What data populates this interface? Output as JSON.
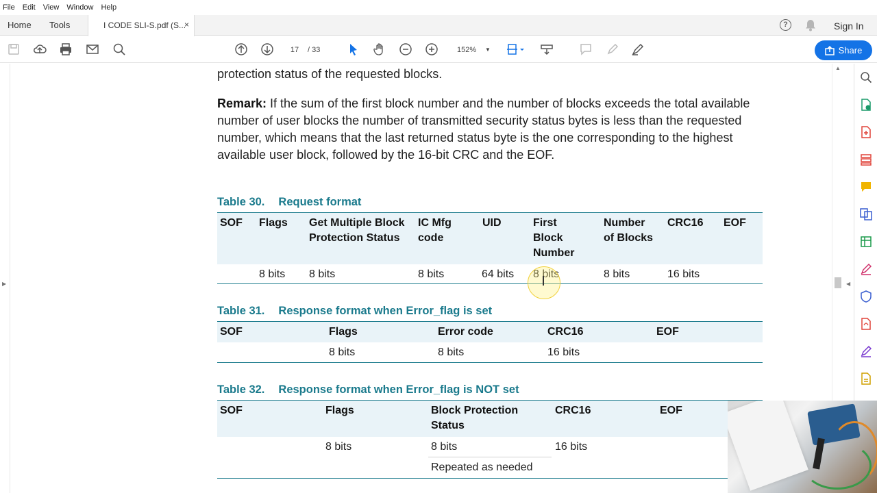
{
  "menu": [
    "File",
    "Edit",
    "View",
    "Window",
    "Help"
  ],
  "tabs": {
    "home": "Home",
    "tools": "Tools",
    "document": "I CODE SLI-S.pdf (S...",
    "close": "×"
  },
  "header": {
    "help": "?",
    "sign_in": "Sign In"
  },
  "toolbar": {
    "current_page": "17",
    "total_pages": "/ 33",
    "zoom": "152%",
    "share_label": "Share"
  },
  "document": {
    "intro_line": "protection status of the requested blocks.",
    "remark_label": "Remark:",
    "remark_text": " If the sum of the first block number and the number of blocks exceeds the total available number of user blocks the number of transmitted security status bytes is less than the requested number, which means that the last returned status byte is the one corresponding to the highest available user block, followed by the 16-bit CRC and the EOF.",
    "table30": {
      "number": "Table 30.",
      "title": "Request format",
      "headers": [
        "SOF",
        "Flags",
        "Get Multiple Block Protection Status",
        "IC Mfg code",
        "UID",
        "First Block Number",
        "Number of Blocks",
        "CRC16",
        "EOF"
      ],
      "row": [
        "",
        "8 bits",
        "8 bits",
        "8 bits",
        "64 bits",
        "8 bits",
        "8 bits",
        "16 bits",
        ""
      ]
    },
    "table31": {
      "number": "Table 31.",
      "title": "Response format when Error_flag is set",
      "headers": [
        "SOF",
        "Flags",
        "Error code",
        "CRC16",
        "EOF"
      ],
      "row": [
        "",
        "8 bits",
        "8 bits",
        "16 bits",
        ""
      ]
    },
    "table32": {
      "number": "Table 32.",
      "title": "Response format when Error_flag is NOT set",
      "headers": [
        "SOF",
        "Flags",
        "Block Protection Status",
        "CRC16",
        "EOF"
      ],
      "row": [
        "",
        "8 bits",
        "8 bits",
        "16 bits",
        ""
      ],
      "note": "Repeated as needed"
    }
  },
  "colors": {
    "accent": "#1473e6",
    "table_teal": "#1a7a8c",
    "table_header_bg": "#e9f3f8"
  }
}
